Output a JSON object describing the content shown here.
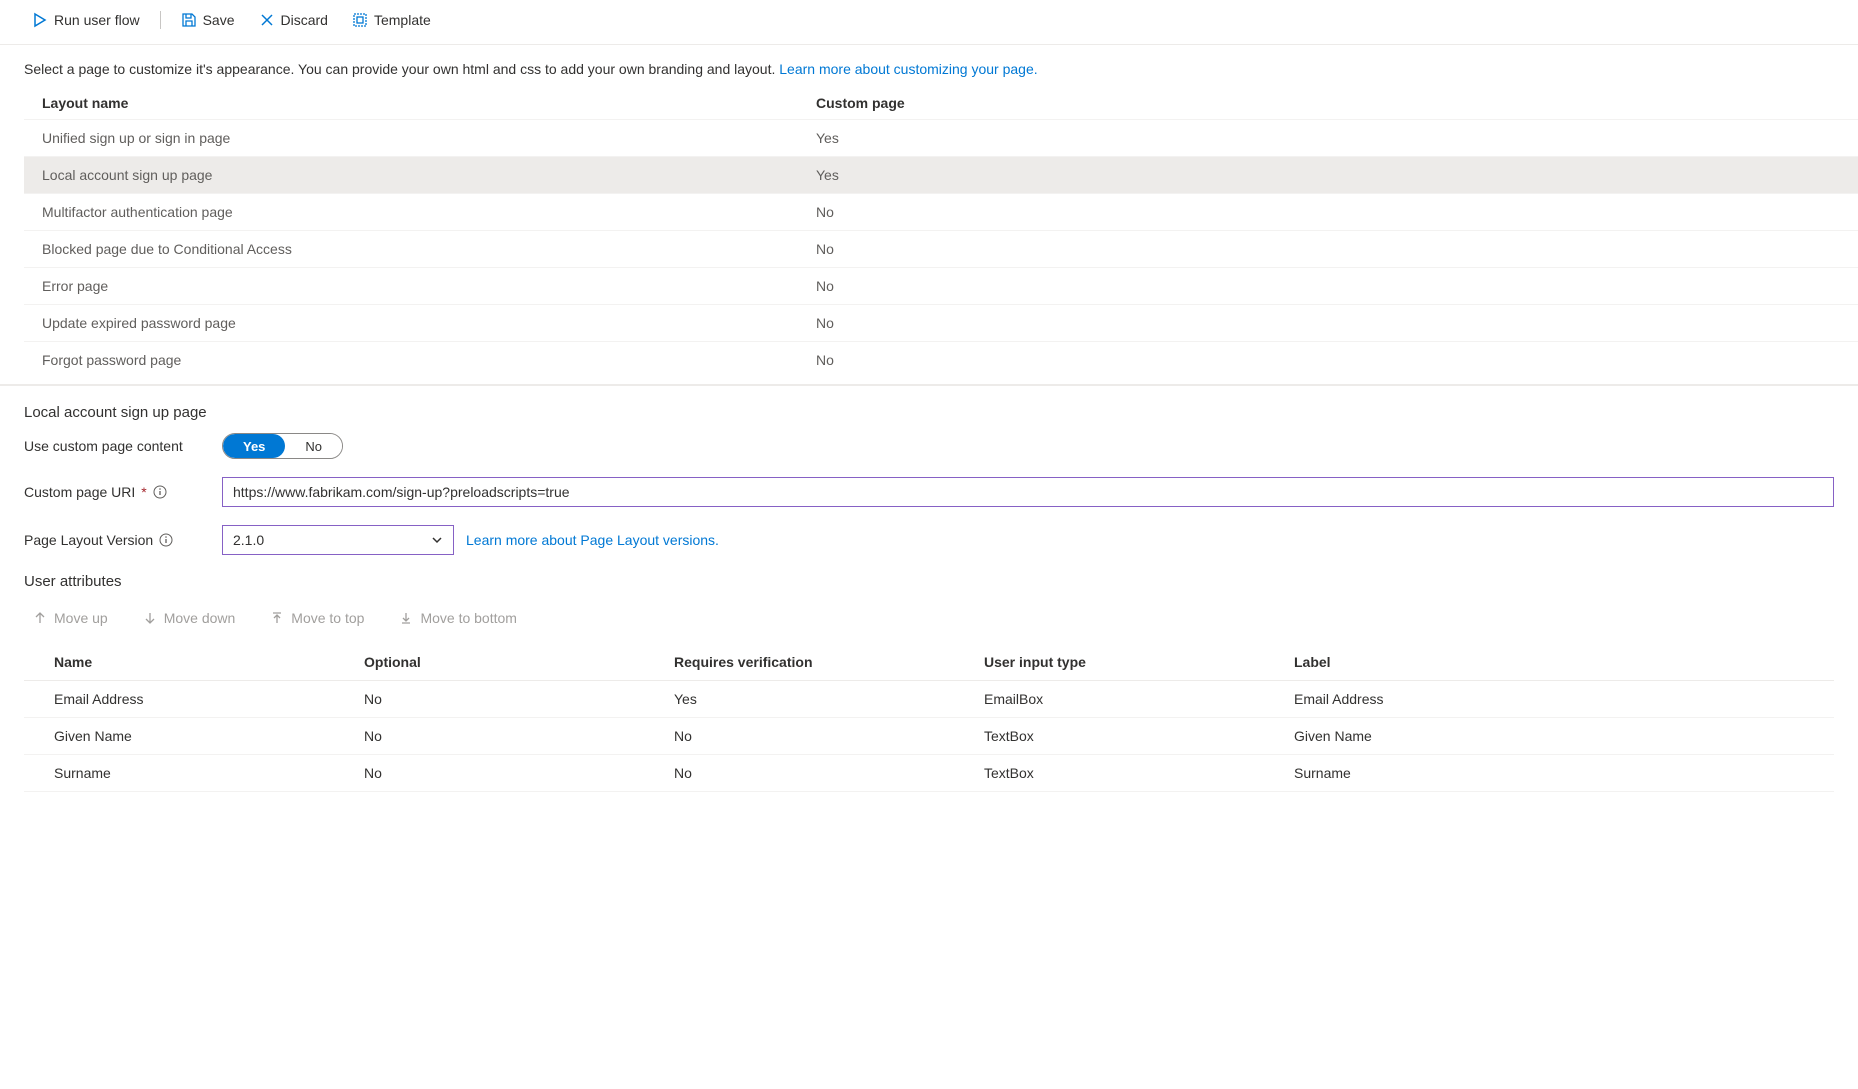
{
  "toolbar": {
    "run_label": "Run user flow",
    "save_label": "Save",
    "discard_label": "Discard",
    "template_label": "Template"
  },
  "description": {
    "text": "Select a page to customize it's appearance. You can provide your own html and css to add your own branding and layout. ",
    "link": "Learn more about customizing your page."
  },
  "layouts": {
    "headers": {
      "name": "Layout name",
      "custom": "Custom page"
    },
    "rows": [
      {
        "name": "Unified sign up or sign in page",
        "custom": "Yes",
        "selected": false
      },
      {
        "name": "Local account sign up page",
        "custom": "Yes",
        "selected": true
      },
      {
        "name": "Multifactor authentication page",
        "custom": "No",
        "selected": false
      },
      {
        "name": "Blocked page due to Conditional Access",
        "custom": "No",
        "selected": false
      },
      {
        "name": "Error page",
        "custom": "No",
        "selected": false
      },
      {
        "name": "Update expired password page",
        "custom": "No",
        "selected": false
      },
      {
        "name": "Forgot password page",
        "custom": "No",
        "selected": false
      }
    ]
  },
  "detail": {
    "title": "Local account sign up page",
    "use_custom_label": "Use custom page content",
    "toggle": {
      "yes": "Yes",
      "no": "No",
      "value": "Yes"
    },
    "uri_label": "Custom page URI",
    "uri_value": "https://www.fabrikam.com/sign-up?preloadscripts=true",
    "version_label": "Page Layout Version",
    "version_value": "2.1.0",
    "version_link": "Learn more about Page Layout versions."
  },
  "attrs": {
    "heading": "User attributes",
    "toolbar": {
      "up": "Move up",
      "down": "Move down",
      "top": "Move to top",
      "bottom": "Move to bottom"
    },
    "headers": {
      "name": "Name",
      "optional": "Optional",
      "verify": "Requires verification",
      "input": "User input type",
      "label": "Label"
    },
    "rows": [
      {
        "name": "Email Address",
        "optional": "No",
        "verify": "Yes",
        "input": "EmailBox",
        "label": "Email Address"
      },
      {
        "name": "Given Name",
        "optional": "No",
        "verify": "No",
        "input": "TextBox",
        "label": "Given Name"
      },
      {
        "name": "Surname",
        "optional": "No",
        "verify": "No",
        "input": "TextBox",
        "label": "Surname"
      }
    ]
  }
}
